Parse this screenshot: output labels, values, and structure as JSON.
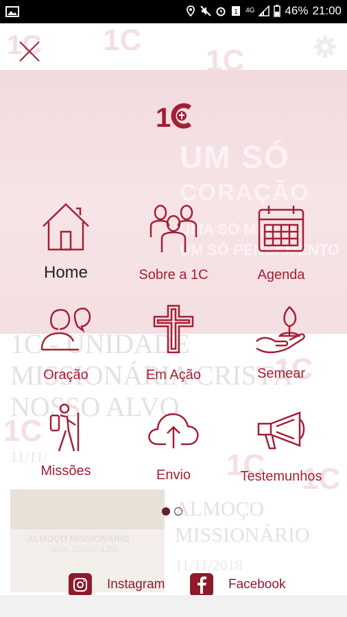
{
  "status_bar": {
    "network": "4G",
    "battery": "46%",
    "time": "21:00",
    "icons": [
      "image-icon",
      "location-icon",
      "mute-icon",
      "alarm-icon",
      "sim-icon",
      "signal-icon"
    ]
  },
  "header": {
    "close_icon": "close-icon",
    "settings_icon": "gear-icon",
    "logo_text": "1C"
  },
  "background": {
    "banner_line1": "UM SÓ",
    "banner_line2": "CORAÇÃO",
    "banner_line3": "UMA SÓ MENTE,",
    "banner_line4": "UM SÓ PENSAMENTO",
    "post1_title_a": "1C - UNIDADE",
    "post1_title_b": "MISSIONÁRIA CRISTÃ -",
    "post1_title_c": "NOSSO ALVO",
    "post1_date": "11/11/",
    "card_title": "ALMOÇO MISSIONÁRIO",
    "card_sub": "dom. 25/nov. 12hs",
    "post2_title_a": "ALMOÇO",
    "post2_title_b": "MISSIONÁRIO",
    "post2_date": "11/11/2018"
  },
  "menu": [
    {
      "label": "Home",
      "icon": "home-icon"
    },
    {
      "label": "Sobre a 1C",
      "icon": "people-icon"
    },
    {
      "label": "Agenda",
      "icon": "calendar-icon"
    },
    {
      "label": "Oração",
      "icon": "prayer-icon"
    },
    {
      "label": "Em Ação",
      "icon": "cross-icon"
    },
    {
      "label": "Semear",
      "icon": "seed-icon"
    },
    {
      "label": "Missões",
      "icon": "hiker-icon"
    },
    {
      "label": "Envio",
      "icon": "cloud-upload-icon"
    },
    {
      "label": "Testemunhos",
      "icon": "megaphone-icon"
    }
  ],
  "pager": {
    "pages": 2,
    "active": 1
  },
  "social": {
    "instagram_label": "Instagram",
    "facebook_label": "Facebook"
  },
  "colors": {
    "accent": "#a31f34",
    "dark_accent": "#8e1a2c",
    "banner_bg": "#f2dadd"
  }
}
